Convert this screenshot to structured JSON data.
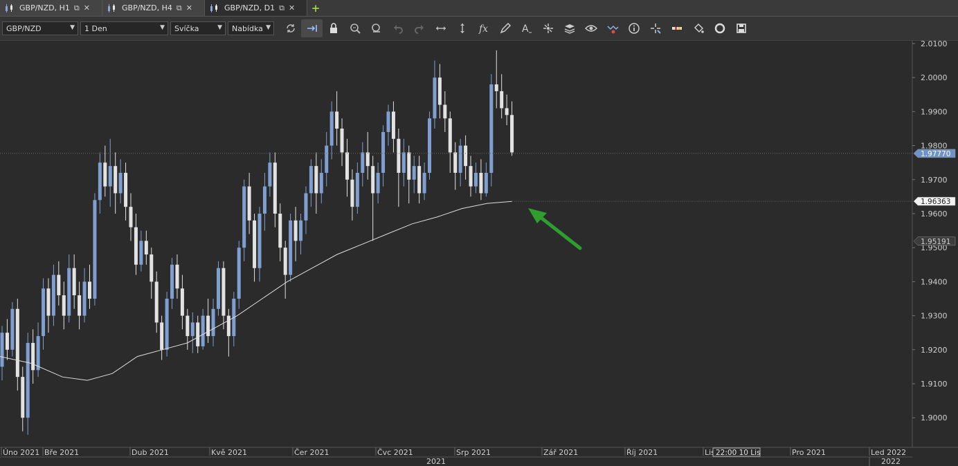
{
  "tabs": [
    {
      "label": "GBP/NZD, H1",
      "active": false
    },
    {
      "label": "GBP/NZD, H4",
      "active": false
    },
    {
      "label": "GBP/NZD, D1",
      "active": true
    }
  ],
  "toolbar": {
    "symbol": "GBP/NZD",
    "period": "1 Den",
    "chart_type": "Svíčka",
    "price_type": "Nabídka"
  },
  "tools": [
    "refresh-icon",
    "scroll-to-end-icon",
    "lock-icon",
    "zoom-in-icon",
    "zoom-out-icon",
    "undo-icon",
    "redo-icon",
    "fit-horizontal-icon",
    "fit-vertical-icon",
    "indicators-fx-icon",
    "pencil-draw-icon",
    "text-tool-icon",
    "objects-icon",
    "layers-icon",
    "eye-icon",
    "alerts-icon",
    "info-icon",
    "crosshair-icon",
    "ruler-icon",
    "paint-bucket-icon",
    "template-icon",
    "save-icon"
  ],
  "chart_data": {
    "type": "candlestick",
    "symbol": "GBP/NZD",
    "timeframe": "D1",
    "y_ticks": [
      "2.0100",
      "2.0000",
      "1.9900",
      "1.9800",
      "1.9700",
      "1.9600",
      "1.9500",
      "1.9400",
      "1.9300",
      "1.9200",
      "1.9100",
      "1.9000"
    ],
    "x_labels": [
      "Úno 2021",
      "Bře 2021",
      "Dub 2021",
      "Kvě 2021",
      "Čer 2021",
      "Čvc 2021",
      "Srp 2021",
      "Zář 2021",
      "Říj 2021",
      "Lis",
      "Pro 2021",
      "Led 2022"
    ],
    "year_labels": [
      "2021",
      "2022"
    ],
    "crosshair_time": "22:00 10 Lis",
    "price_labels": {
      "current": "1.97770",
      "ma": "1.96363",
      "level": "1.95191"
    },
    "moving_average": [
      [
        0,
        1.918
      ],
      [
        0.05,
        1.916
      ],
      [
        0.1,
        1.912
      ],
      [
        0.14,
        1.911
      ],
      [
        0.18,
        1.913
      ],
      [
        0.22,
        1.918
      ],
      [
        0.26,
        1.92
      ],
      [
        0.3,
        1.922
      ],
      [
        0.34,
        1.926
      ],
      [
        0.38,
        1.93
      ],
      [
        0.42,
        1.935
      ],
      [
        0.46,
        1.94
      ],
      [
        0.5,
        1.944
      ],
      [
        0.54,
        1.948
      ],
      [
        0.58,
        1.951
      ],
      [
        0.62,
        1.954
      ],
      [
        0.66,
        1.957
      ],
      [
        0.7,
        1.959
      ],
      [
        0.74,
        1.9615
      ],
      [
        0.78,
        1.963
      ],
      [
        0.8,
        1.9633
      ],
      [
        0.82,
        1.9636
      ]
    ],
    "candles": [
      [
        1.915,
        1.925,
        1.911,
        1.927
      ],
      [
        1.925,
        1.92,
        1.917,
        1.929
      ],
      [
        1.92,
        1.932,
        1.918,
        1.934
      ],
      [
        1.932,
        1.912,
        1.908,
        1.935
      ],
      [
        1.912,
        1.9,
        1.896,
        1.915
      ],
      [
        1.9,
        1.922,
        1.895,
        1.925
      ],
      [
        1.922,
        1.914,
        1.91,
        1.926
      ],
      [
        1.914,
        1.924,
        1.912,
        1.928
      ],
      [
        1.924,
        1.938,
        1.92,
        1.941
      ],
      [
        1.938,
        1.93,
        1.925,
        1.941
      ],
      [
        1.93,
        1.942,
        1.927,
        1.945
      ],
      [
        1.942,
        1.936,
        1.933,
        1.946
      ],
      [
        1.936,
        1.93,
        1.926,
        1.94
      ],
      [
        1.93,
        1.944,
        1.928,
        1.948
      ],
      [
        1.944,
        1.936,
        1.932,
        1.948
      ],
      [
        1.936,
        1.93,
        1.926,
        1.94
      ],
      [
        1.93,
        1.94,
        1.928,
        1.944
      ],
      [
        1.94,
        1.935,
        1.932,
        1.945
      ],
      [
        1.935,
        1.964,
        1.933,
        1.966
      ],
      [
        1.964,
        1.975,
        1.96,
        1.978
      ],
      [
        1.975,
        1.968,
        1.965,
        1.98
      ],
      [
        1.968,
        1.974,
        1.962,
        1.982
      ],
      [
        1.974,
        1.966,
        1.96,
        1.978
      ],
      [
        1.966,
        1.972,
        1.963,
        1.976
      ],
      [
        1.972,
        1.962,
        1.958,
        1.975
      ],
      [
        1.962,
        1.956,
        1.952,
        1.966
      ],
      [
        1.956,
        1.945,
        1.942,
        1.96
      ],
      [
        1.945,
        1.952,
        1.943,
        1.955
      ],
      [
        1.952,
        1.948,
        1.945,
        1.955
      ],
      [
        1.948,
        1.94,
        1.935,
        1.95
      ],
      [
        1.94,
        1.928,
        1.925,
        1.943
      ],
      [
        1.928,
        1.92,
        1.917,
        1.93
      ],
      [
        1.92,
        1.935,
        1.918,
        1.937
      ],
      [
        1.935,
        1.945,
        1.932,
        1.947
      ],
      [
        1.945,
        1.938,
        1.935,
        1.948
      ],
      [
        1.938,
        1.93,
        1.926,
        1.942
      ],
      [
        1.93,
        1.924,
        1.92,
        1.932
      ],
      [
        1.924,
        1.928,
        1.919,
        1.931
      ],
      [
        1.928,
        1.921,
        1.919,
        1.93
      ],
      [
        1.921,
        1.93,
        1.92,
        1.932
      ],
      [
        1.93,
        1.924,
        1.922,
        1.935
      ],
      [
        1.924,
        1.932,
        1.921,
        1.935
      ],
      [
        1.932,
        1.944,
        1.93,
        1.946
      ],
      [
        1.944,
        1.93,
        1.926,
        1.946
      ],
      [
        1.93,
        1.924,
        1.918,
        1.932
      ],
      [
        1.924,
        1.935,
        1.921,
        1.937
      ],
      [
        1.935,
        1.95,
        1.932,
        1.952
      ],
      [
        1.95,
        1.968,
        1.946,
        1.97
      ],
      [
        1.968,
        1.958,
        1.954,
        1.972
      ],
      [
        1.958,
        1.944,
        1.94,
        1.96
      ],
      [
        1.944,
        1.96,
        1.94,
        1.962
      ],
      [
        1.96,
        1.968,
        1.955,
        1.972
      ],
      [
        1.968,
        1.975,
        1.965,
        1.978
      ],
      [
        1.975,
        1.96,
        1.956,
        1.978
      ],
      [
        1.96,
        1.95,
        1.946,
        1.963
      ],
      [
        1.95,
        1.942,
        1.935,
        1.952
      ],
      [
        1.942,
        1.958,
        1.94,
        1.96
      ],
      [
        1.958,
        1.952,
        1.946,
        1.962
      ],
      [
        1.952,
        1.958,
        1.948,
        1.96
      ],
      [
        1.958,
        1.966,
        1.954,
        1.968
      ],
      [
        1.966,
        1.974,
        1.962,
        1.976
      ],
      [
        1.974,
        1.966,
        1.96,
        1.978
      ],
      [
        1.966,
        1.972,
        1.963,
        1.976
      ],
      [
        1.972,
        1.98,
        1.968,
        1.984
      ],
      [
        1.98,
        1.99,
        1.976,
        1.993
      ],
      [
        1.99,
        1.985,
        1.98,
        1.996
      ],
      [
        1.985,
        1.978,
        1.974,
        1.988
      ],
      [
        1.978,
        1.97,
        1.965,
        1.982
      ],
      [
        1.97,
        1.962,
        1.958,
        1.973
      ],
      [
        1.962,
        1.972,
        1.96,
        1.975
      ],
      [
        1.972,
        1.978,
        1.968,
        1.981
      ],
      [
        1.978,
        1.974,
        1.97,
        1.984
      ],
      [
        1.974,
        1.966,
        1.952,
        1.977
      ],
      [
        1.966,
        1.972,
        1.963,
        1.975
      ],
      [
        1.972,
        1.984,
        1.968,
        1.986
      ],
      [
        1.984,
        1.99,
        1.98,
        1.992
      ],
      [
        1.99,
        1.982,
        1.978,
        1.993
      ],
      [
        1.982,
        1.972,
        1.962,
        1.985
      ],
      [
        1.972,
        1.978,
        1.968,
        1.982
      ],
      [
        1.978,
        1.97,
        1.963,
        1.98
      ],
      [
        1.97,
        1.974,
        1.966,
        1.977
      ],
      [
        1.974,
        1.966,
        1.963,
        1.977
      ],
      [
        1.966,
        1.972,
        1.964,
        1.975
      ],
      [
        1.972,
        1.988,
        1.97,
        1.99
      ],
      [
        1.988,
        2.0,
        1.985,
        2.005
      ],
      [
        2.0,
        1.992,
        1.988,
        2.004
      ],
      [
        1.992,
        1.988,
        1.984,
        1.996
      ],
      [
        1.988,
        1.978,
        1.972,
        1.99
      ],
      [
        1.978,
        1.972,
        1.967,
        1.981
      ],
      [
        1.972,
        1.98,
        1.968,
        1.982
      ],
      [
        1.98,
        1.974,
        1.97,
        1.983
      ],
      [
        1.974,
        1.968,
        1.965,
        1.977
      ],
      [
        1.968,
        1.972,
        1.966,
        1.975
      ],
      [
        1.972,
        1.966,
        1.964,
        1.976
      ],
      [
        1.966,
        1.972,
        1.965,
        1.975
      ],
      [
        1.972,
        1.998,
        1.968,
        2.001
      ],
      [
        1.998,
        1.996,
        1.991,
        2.008
      ],
      [
        1.996,
        1.991,
        1.988,
        2.001
      ],
      [
        1.991,
        1.989,
        1.986,
        1.995
      ],
      [
        1.989,
        1.978,
        1.977,
        1.993
      ]
    ]
  }
}
